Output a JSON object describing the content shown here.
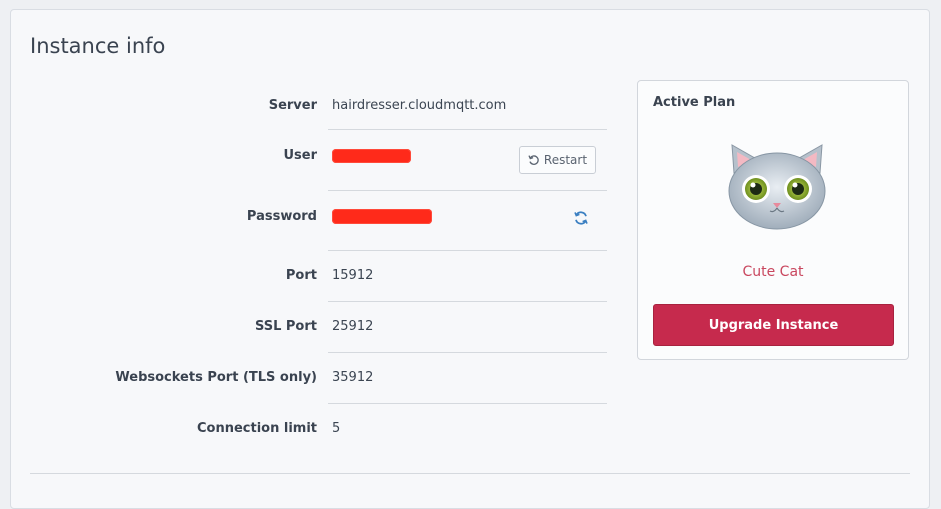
{
  "panel": {
    "title": "Instance info"
  },
  "fields": {
    "server": {
      "label": "Server",
      "value": "hairdresser.cloudmqtt.com"
    },
    "user": {
      "label": "User",
      "restart_label": "Restart"
    },
    "password": {
      "label": "Password"
    },
    "port": {
      "label": "Port",
      "value": "15912"
    },
    "ssl_port": {
      "label": "SSL Port",
      "value": "25912"
    },
    "websockets_port": {
      "label": "Websockets Port (TLS only)",
      "value": "35912"
    },
    "connection_limit": {
      "label": "Connection limit",
      "value": "5"
    }
  },
  "plan": {
    "title": "Active Plan",
    "name": "Cute Cat",
    "upgrade_label": "Upgrade Instance"
  },
  "colors": {
    "accent": "#c62a4d",
    "plan_name": "#c9475f",
    "redaction": "#ff2a1a",
    "refresh_icon": "#3a7fc1"
  },
  "icons": {
    "restart": "rotate-ccw-icon",
    "password_refresh": "refresh-icon",
    "plan_image": "cat-emoji-icon"
  }
}
